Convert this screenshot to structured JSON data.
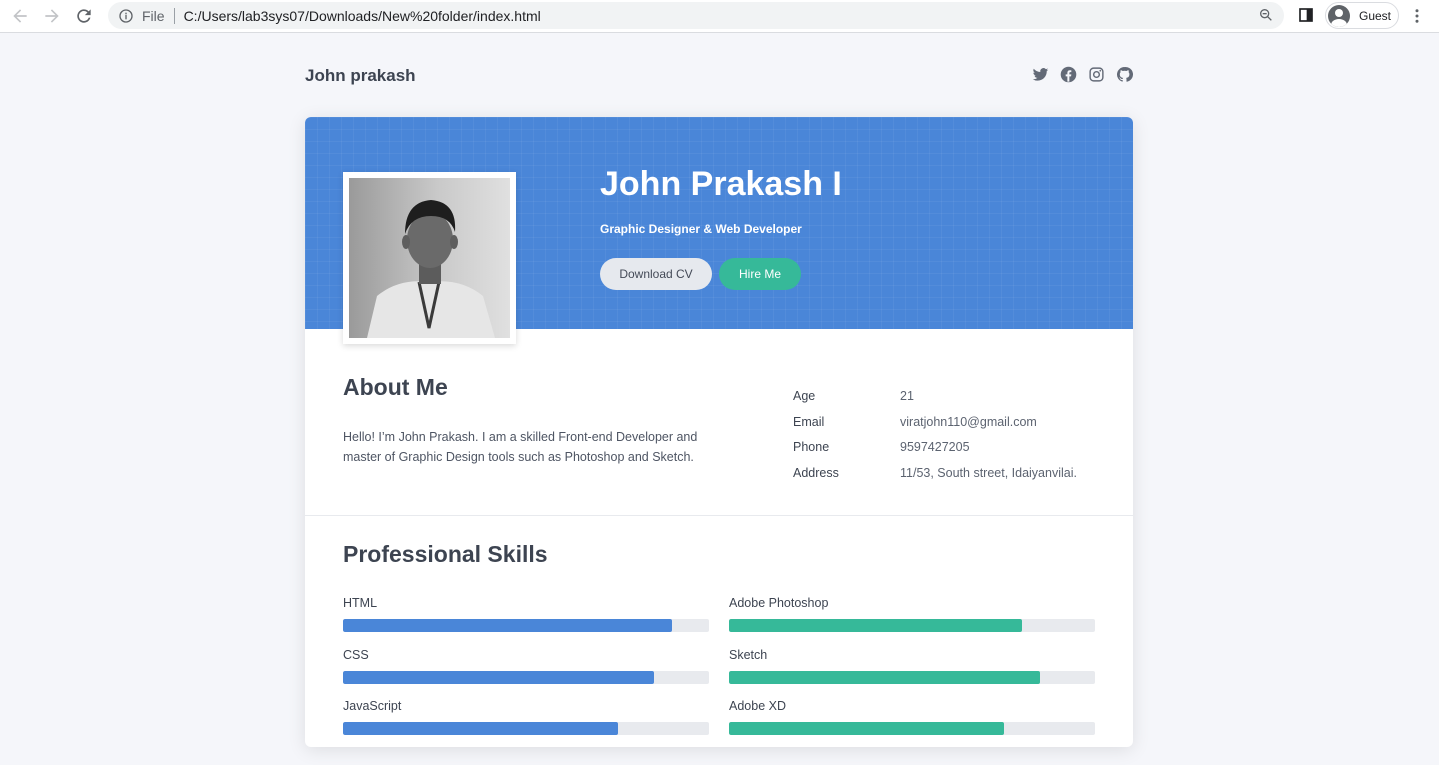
{
  "browser": {
    "scheme_label": "File",
    "url": "C:/Users/lab3sys07/Downloads/New%20folder/index.html",
    "profile_label": "Guest"
  },
  "header": {
    "brand": "John prakash",
    "social_icons": [
      "twitter-icon",
      "facebook-icon",
      "instagram-icon",
      "github-icon"
    ]
  },
  "hero": {
    "name": "John Prakash I",
    "role": "Graphic Designer & Web Developer",
    "download_label": "Download CV",
    "hire_label": "Hire Me"
  },
  "about": {
    "title": "About Me",
    "text": "Hello! I’m John Prakash. I am a skilled Front-end Developer and master of Graphic Design tools such as Photoshop and Sketch.",
    "details": [
      {
        "label": "Age",
        "value": "21"
      },
      {
        "label": "Email",
        "value": "viratjohn110@gmail.com"
      },
      {
        "label": "Phone",
        "value": "9597427205"
      },
      {
        "label": "Address",
        "value": "11/53, South street, Idaiyanvilai."
      }
    ]
  },
  "skills": {
    "title": "Professional Skills",
    "left": [
      {
        "name": "HTML",
        "level": 0.9
      },
      {
        "name": "CSS",
        "level": 0.85
      },
      {
        "name": "JavaScript",
        "level": 0.75
      }
    ],
    "right": [
      {
        "name": "Adobe Photoshop",
        "level": 0.8
      },
      {
        "name": "Sketch",
        "level": 0.85
      },
      {
        "name": "Adobe XD",
        "level": 0.75
      }
    ]
  },
  "colors": {
    "hero_blue": "#4a86d8",
    "accent_green": "#36b999",
    "skill_blue": "#4a86d8",
    "skill_green": "#36b999"
  }
}
